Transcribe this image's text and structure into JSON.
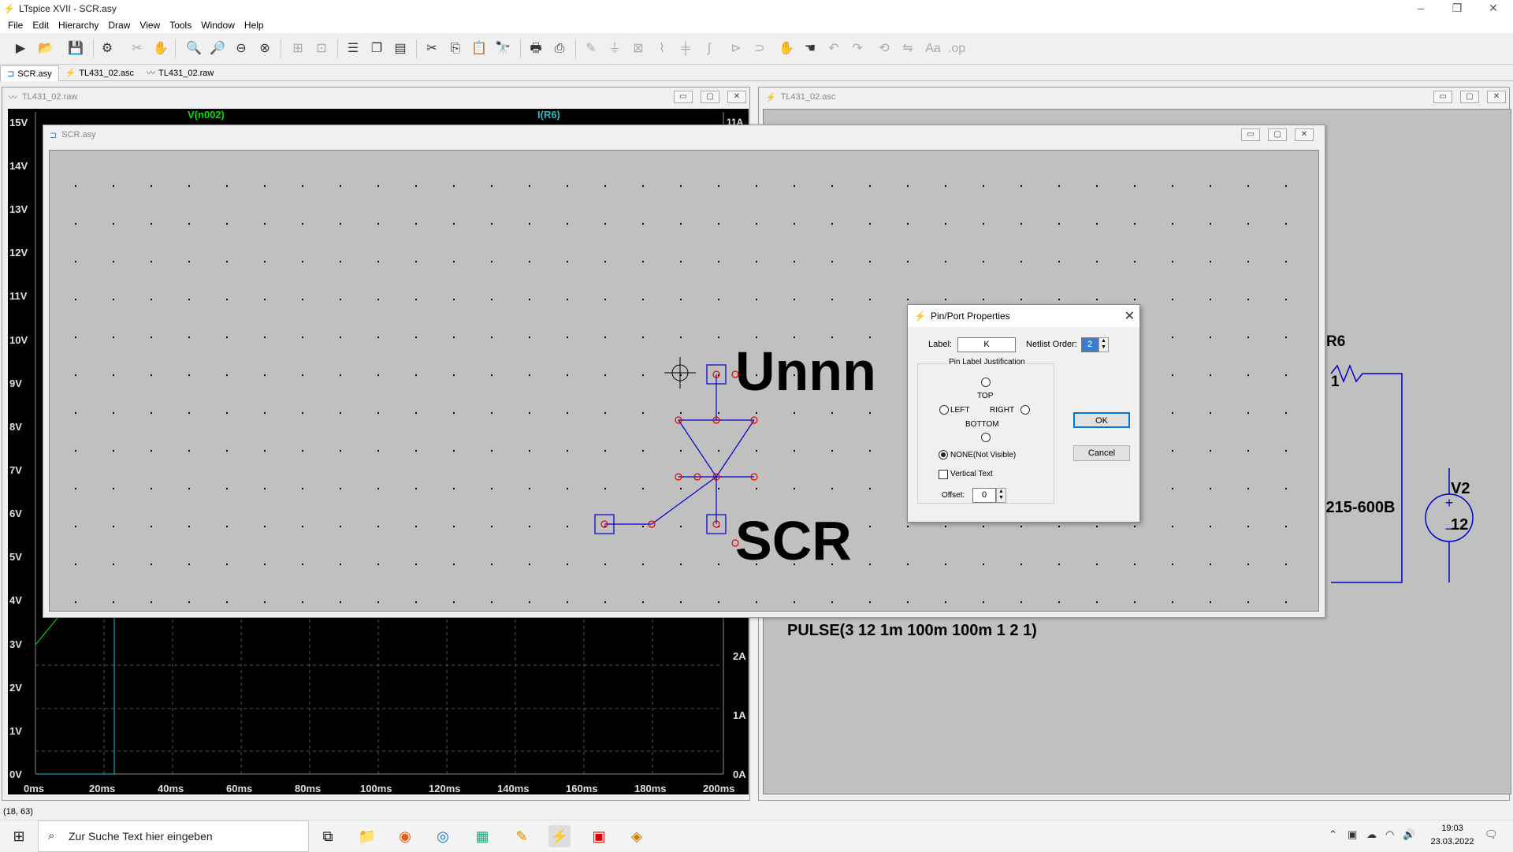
{
  "window": {
    "title": "LTspice XVII - SCR.asy",
    "minimize": "–",
    "restore": "❐",
    "close": "✕"
  },
  "menu": [
    "File",
    "Edit",
    "Hierarchy",
    "Draw",
    "View",
    "Tools",
    "Window",
    "Help"
  ],
  "tabs": [
    {
      "label": "SCR.asy",
      "icon": "symbol-icon"
    },
    {
      "label": "TL431_02.asc",
      "icon": "schematic-icon"
    },
    {
      "label": "TL431_02.raw",
      "icon": "waveform-icon"
    }
  ],
  "plot_window": {
    "title": "TL431_02.raw",
    "trace1": "V(n002)",
    "trace2": "I(R6)",
    "trace1_color": "#00e000",
    "trace2_color": "#20c0c0",
    "right_top_label": "11A",
    "y_ticks": [
      "15V",
      "14V",
      "13V",
      "12V",
      "11V",
      "10V",
      "9V",
      "8V",
      "7V",
      "6V",
      "5V",
      "4V",
      "3V",
      "2V",
      "1V",
      "0V"
    ],
    "right_ticks": [
      "2A",
      "1A",
      "0A"
    ],
    "x_ticks": [
      "0ms",
      "20ms",
      "40ms",
      "60ms",
      "80ms",
      "100ms",
      "120ms",
      "140ms",
      "160ms",
      "180ms",
      "200ms"
    ]
  },
  "schematic_window": {
    "title": "TL431_02.asc",
    "r6_label": "R6",
    "r6_value": "1",
    "v2_label": "V2",
    "v2_value": "12",
    "part_text": ".215-600B",
    "pulse_text": "PULSE(3 12 1m 100m 100m 1 2 1)"
  },
  "symbol_window": {
    "title": "SCR.asy",
    "attr_text": "Unnn",
    "name_text": "SCR"
  },
  "dialog": {
    "title": "Pin/Port Properties",
    "label_caption": "Label:",
    "label_value": "K",
    "netlist_caption": "Netlist Order:",
    "netlist_value": "2",
    "group_title": "Pin Label Justification",
    "top": "TOP",
    "left": "LEFT",
    "right": "RIGHT",
    "bottom": "BOTTOM",
    "none": "NONE(Not Visible)",
    "vertical": "Vertical Text",
    "offset_caption": "Offset:",
    "offset_value": "0",
    "ok": "OK",
    "cancel": "Cancel",
    "selected_justification": "NONE",
    "vertical_checked": false
  },
  "status": "(18, 63)",
  "taskbar": {
    "search_placeholder": "Zur Suche Text hier eingeben",
    "time": "19:03",
    "date": "23.03.2022"
  }
}
